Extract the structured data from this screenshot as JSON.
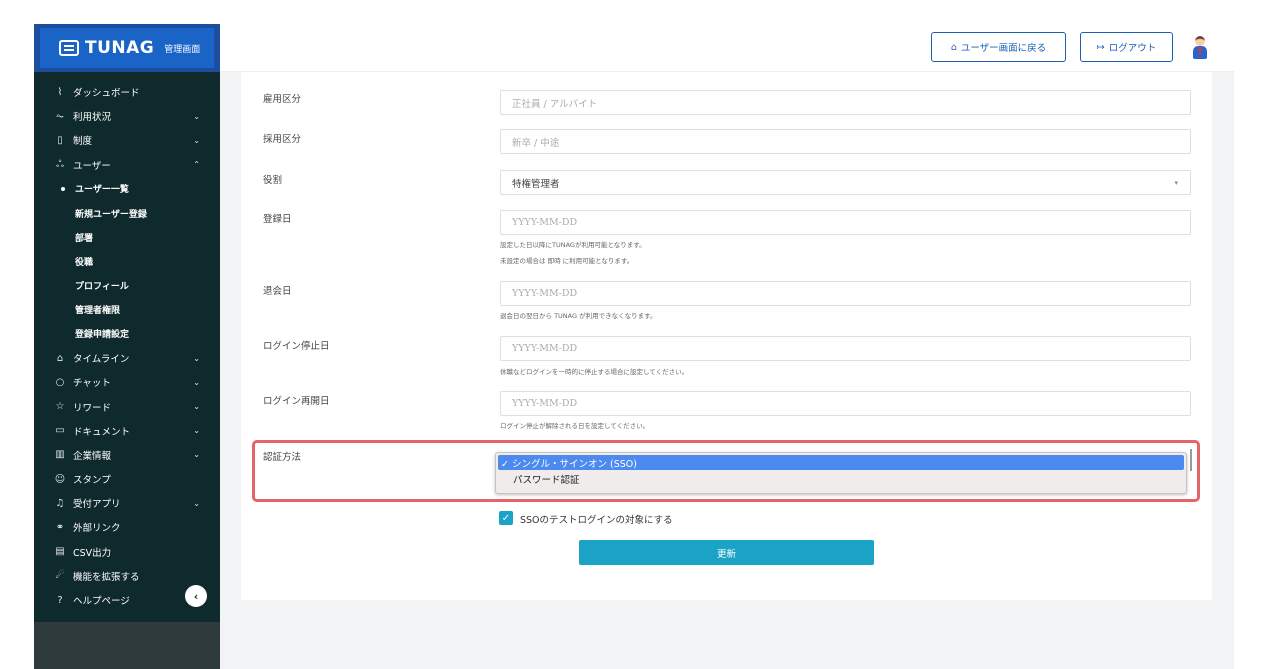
{
  "brand": {
    "name": "TUNAG",
    "subtitle": "管理画面"
  },
  "header": {
    "back_button": "ユーザー画面に戻る",
    "logout_button": "ログアウト",
    "home_icon": "⌂",
    "logout_icon": "↦"
  },
  "sidebar": {
    "items": [
      {
        "label": "ダッシュボード",
        "icon": "chart-icon",
        "glyph": "⌇"
      },
      {
        "label": "利用状況",
        "icon": "pulse-icon",
        "glyph": "⏦",
        "chevron": "⌄"
      },
      {
        "label": "制度",
        "icon": "book-icon",
        "glyph": "▯",
        "chevron": "⌄"
      },
      {
        "label": "ユーザー",
        "icon": "users-icon",
        "glyph": "ஃ",
        "chevron": "⌃"
      },
      {
        "label": "ユーザー一覧"
      },
      {
        "label": "新規ユーザー登録"
      },
      {
        "label": "部署"
      },
      {
        "label": "役職"
      },
      {
        "label": "プロフィール"
      },
      {
        "label": "管理者権限"
      },
      {
        "label": "登録申請設定"
      },
      {
        "label": "タイムライン",
        "icon": "home-icon",
        "glyph": "⌂",
        "chevron": "⌄"
      },
      {
        "label": "チャット",
        "icon": "chat-icon",
        "glyph": "○",
        "chevron": "⌄"
      },
      {
        "label": "リワード",
        "icon": "star-icon",
        "glyph": "☆",
        "chevron": "⌄"
      },
      {
        "label": "ドキュメント",
        "icon": "folder-icon",
        "glyph": "▭",
        "chevron": "⌄"
      },
      {
        "label": "企業情報",
        "icon": "building-icon",
        "glyph": "▥",
        "chevron": "⌄"
      },
      {
        "label": "スタンプ",
        "icon": "smile-icon",
        "glyph": "☺"
      },
      {
        "label": "受付アプリ",
        "icon": "bell-icon",
        "glyph": "♫",
        "chevron": "⌄"
      },
      {
        "label": "外部リンク",
        "icon": "link-icon",
        "glyph": "⚭"
      },
      {
        "label": "CSV出力",
        "icon": "table-icon",
        "glyph": "▤"
      },
      {
        "label": "機能を拡張する",
        "icon": "rocket-icon",
        "glyph": "☄"
      },
      {
        "label": "ヘルプページ",
        "icon": "help-icon",
        "glyph": "?"
      }
    ],
    "collapse": "‹"
  },
  "form": {
    "employment": {
      "label": "雇用区分",
      "placeholder": "正社員 / アルバイト"
    },
    "hiring": {
      "label": "採用区分",
      "placeholder": "新卒 / 中途"
    },
    "role": {
      "label": "役割",
      "value": "特権管理者",
      "arrow": "▾"
    },
    "registered": {
      "label": "登録日",
      "placeholder": "YYYY-MM-DD",
      "help1": "設定した日以降にTUNAGが利用可能となります。",
      "help2": "未設定の場合は 即時 に利用可能となります。"
    },
    "withdrawal": {
      "label": "退会日",
      "placeholder": "YYYY-MM-DD",
      "help": "退会日の翌日から TUNAG が利用できなくなります。"
    },
    "login_stop": {
      "label": "ログイン停止日",
      "placeholder": "YYYY-MM-DD",
      "help": "休職などログインを一時的に停止する場合に設定してください。"
    },
    "login_resume": {
      "label": "ログイン再開日",
      "placeholder": "YYYY-MM-DD",
      "help": "ログイン停止が解除される日を設定してください。"
    },
    "auth": {
      "label": "認証方法",
      "options": [
        "✓ シングル・サインオン (SSO)",
        "パスワード認証"
      ]
    },
    "sso_test": {
      "label": "SSOのテストログインの対象にする",
      "checked": "✓"
    },
    "submit": "更新"
  }
}
